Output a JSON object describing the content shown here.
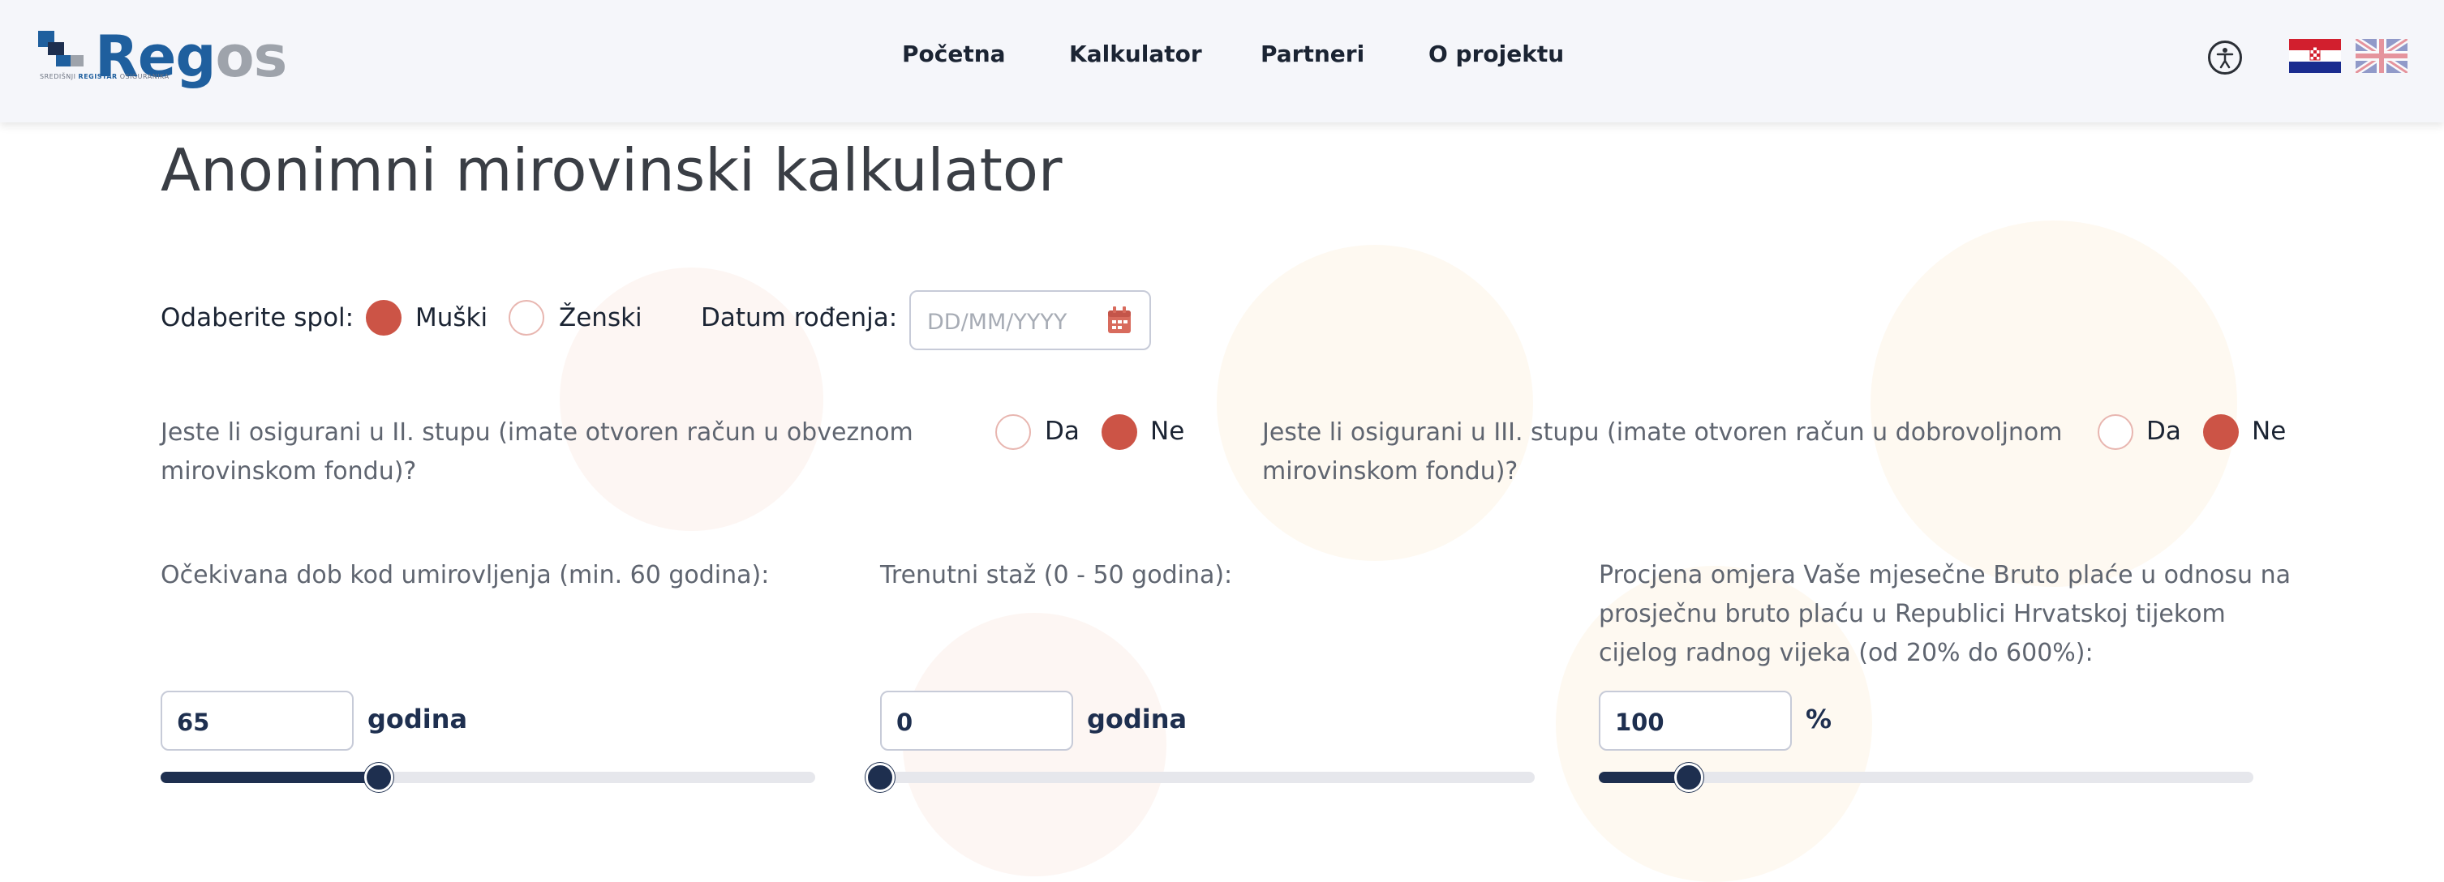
{
  "colors": {
    "accent": "#cc5446",
    "navy": "#1e2f4f",
    "logo_blue": "#1f5f9e",
    "logo_gray": "#9ea3ab"
  },
  "header": {
    "logo": {
      "part1": "Reg",
      "part2": "os",
      "tagline_pre": "SREDIŠNJI ",
      "tagline_bold": "REGISTAR",
      "tagline_post": " OSIGURANIKA"
    },
    "nav": [
      "Početna",
      "Kalkulator",
      "Partneri",
      "O projektu"
    ],
    "icons": {
      "accessibility": "accessibility-icon",
      "lang_hr": "croatian-flag-icon",
      "lang_en": "uk-flag-icon"
    }
  },
  "page_title": "Anonimni mirovinski kalkulator",
  "gender": {
    "label": "Odaberite spol:",
    "options": [
      "Muški",
      "Ženski"
    ],
    "selected": "Muški"
  },
  "birth_date": {
    "label": "Datum rođenja:",
    "placeholder": "DD/MM/YYYY",
    "icon": "calendar-icon"
  },
  "pillar2": {
    "question": "Jeste li osigurani u II. stupu (imate otvoren račun u obveznom mirovinskom fondu)?",
    "yes": "Da",
    "no": "Ne",
    "selected": "Ne"
  },
  "pillar3": {
    "question": "Jeste li osigurani u III. stupu (imate otvoren račun u dobrovoljnom mirovinskom fondu)?",
    "yes": "Da",
    "no": "Ne",
    "selected": "Ne"
  },
  "retirement_age": {
    "label": "Očekivana dob kod umirovljenja (min. 60 godina):",
    "value": "65",
    "unit": "godina",
    "slider_fraction": 0.333
  },
  "service": {
    "label": "Trenutni staž (0 - 50 godina):",
    "value": "0",
    "unit": "godina",
    "slider_fraction": 0.0
  },
  "salary_ratio": {
    "label": "Procjena omjera Vaše mjesečne Bruto plaće u odnosu na prosječnu bruto plaću u Republici Hrvatskoj tijekom cijelog radnog vijeka (od 20% do 600%):",
    "value": "100",
    "unit": "%",
    "slider_fraction": 0.138
  }
}
